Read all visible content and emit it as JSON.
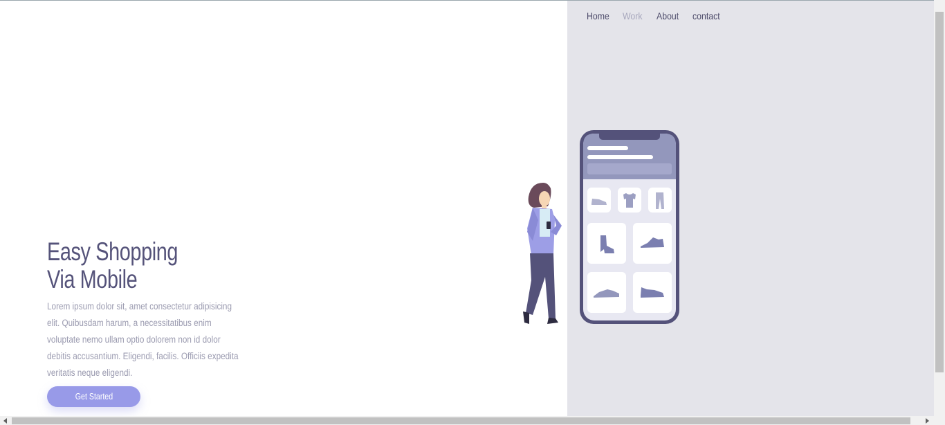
{
  "nav": {
    "items": [
      {
        "label": "Home",
        "active": false
      },
      {
        "label": "Work",
        "active": true
      },
      {
        "label": "About",
        "active": false
      },
      {
        "label": "contact",
        "active": false
      }
    ]
  },
  "hero": {
    "title_line1": "Easy Shopping",
    "title_line2": "Via Mobile",
    "description": "Lorem ipsum dolor sit, amet consectetur adipisicing elit. Quibusdam harum, a necessitatibus enim voluptate nemo ullam optio dolorem non id dolor debitis accusantium. Eligendi, facilis. Officiis expedita veritatis neque eligendi.",
    "cta_label": "Get Started"
  },
  "colors": {
    "accent": "#989ae8",
    "title": "#55537a",
    "panel": "#e4e4ea",
    "phone_frame": "#54527a"
  },
  "illustration": {
    "icons": [
      "woman-icon",
      "phone-icon",
      "shoe-icon",
      "tshirt-icon",
      "pants-icon",
      "boot-icon",
      "sneaker-icon"
    ]
  }
}
